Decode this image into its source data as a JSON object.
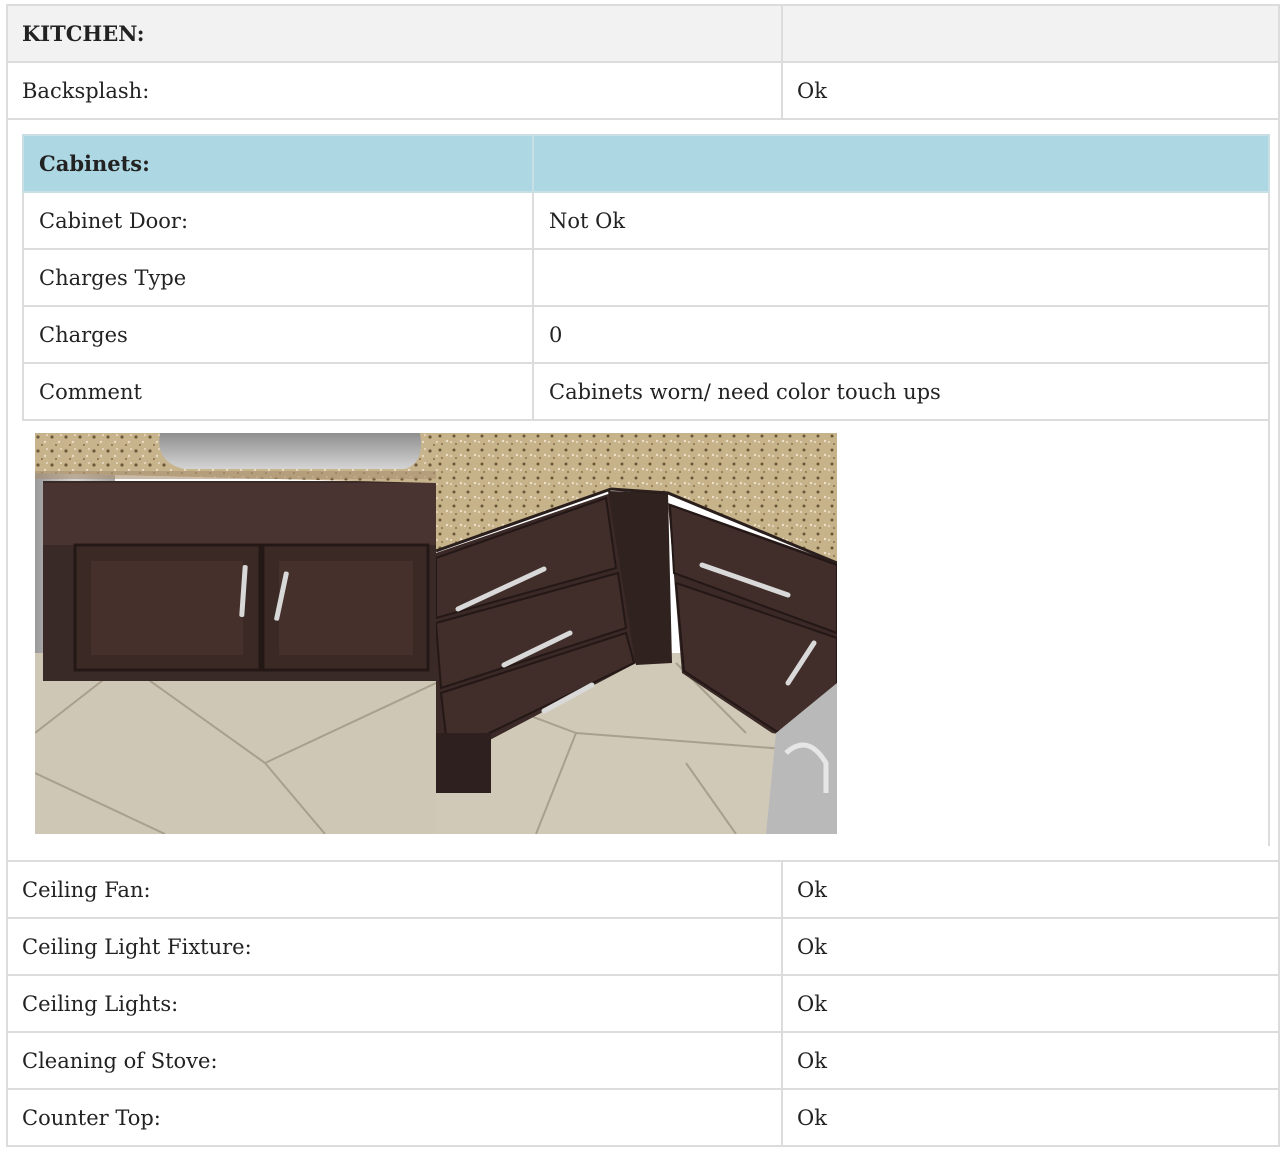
{
  "section": {
    "title": "KITCHEN:",
    "value": ""
  },
  "rows_before": [
    {
      "label": "Backsplash:",
      "value": "Ok"
    }
  ],
  "cabinets": {
    "title": "Cabinets:",
    "header_value": "",
    "rows": [
      {
        "label": "Cabinet Door:",
        "value": "Not Ok"
      },
      {
        "label": "Charges Type",
        "value": ""
      },
      {
        "label": "Charges",
        "value": "0"
      },
      {
        "label": "Comment",
        "value": "Cabinets worn/ need color touch ups"
      }
    ],
    "photos": [
      "cabinet-sink-photo",
      "cabinet-corner-photo"
    ]
  },
  "rows_after": [
    {
      "label": "Ceiling Fan:",
      "value": "Ok"
    },
    {
      "label": "Ceiling Light Fixture:",
      "value": "Ok"
    },
    {
      "label": "Ceiling Lights:",
      "value": "Ok"
    },
    {
      "label": "Cleaning of Stove:",
      "value": "Ok"
    },
    {
      "label": "Counter Top:",
      "value": "Ok"
    }
  ]
}
